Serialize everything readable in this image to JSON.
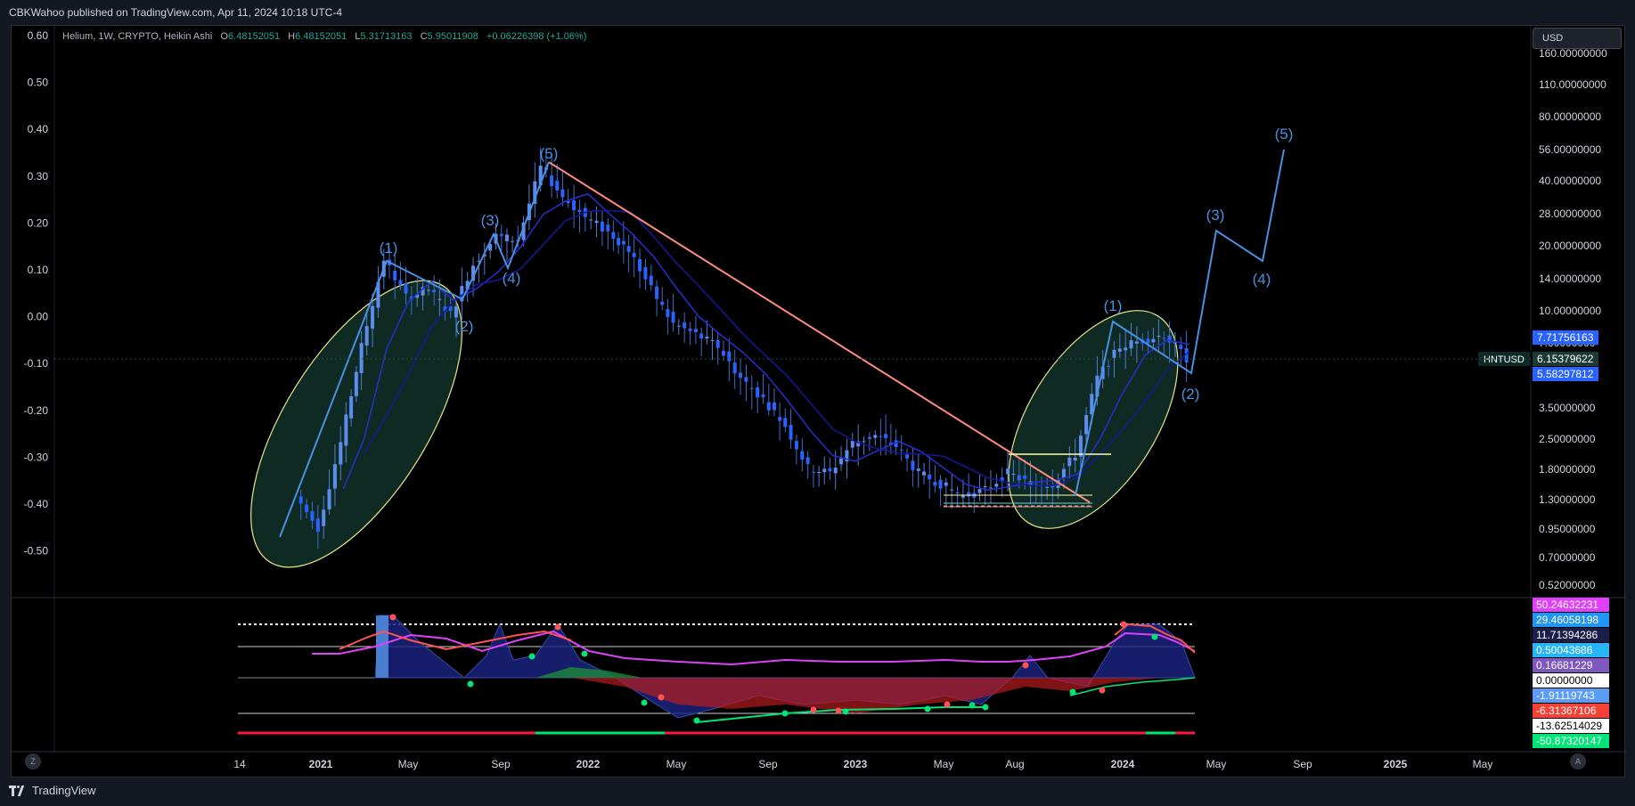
{
  "header": {
    "published_text": "CBKWahoo published on TradingView.com, Apr 11, 2024 10:18 UTC-4"
  },
  "legend": {
    "symbol_line": "Helium, 1W, CRYPTO, Heikin Ashi",
    "o_key": "O",
    "o_val": "6.48152051",
    "h_key": "H",
    "h_val": "6.48152051",
    "l_key": "L",
    "l_val": "5.31713163",
    "c_key": "C",
    "c_val": "5.95011908",
    "change": "+0.06226398 (+1.06%)"
  },
  "currency_button": "USD",
  "footer": {
    "brand": "TradingView",
    "z_button": "Z",
    "a_button": "A"
  },
  "colors": {
    "background": "#000000",
    "frame": "#131722",
    "candle": "#2962ff",
    "ma": "#1a1fbf",
    "wave": "#4a90e2",
    "trendline": "#ff8a80",
    "ellipse_stroke": "#e6e68a",
    "ellipse_fill": "#0f2a22",
    "range_line": "#ffffaa",
    "text": "#d1d4dc"
  },
  "chart_data": {
    "type": "candlestick",
    "title": "Helium, 1W, CRYPTO, Heikin Ashi",
    "symbol": "HNTUSD",
    "x_ticks": [
      "14",
      "2021",
      "May",
      "Sep",
      "2022",
      "May",
      "Sep",
      "2023",
      "May",
      "Aug",
      "2024",
      "May",
      "Sep",
      "2025",
      "May"
    ],
    "left_axis_ticks": [
      "0.60",
      "0.50",
      "0.40",
      "0.30",
      "0.20",
      "0.10",
      "0.00",
      "-0.10",
      "-0.20",
      "-0.30",
      "-0.40",
      "-0.50"
    ],
    "right_axis_ticks": [
      "160.00000000",
      "110.00000000",
      "80.00000000",
      "56.00000000",
      "40.00000000",
      "28.00000000",
      "20.00000000",
      "14.00000000",
      "10.00000000",
      "7.00000000",
      "3.50000000",
      "2.50000000",
      "1.80000000",
      "1.30000000",
      "0.95000000",
      "0.70000000",
      "0.52000000"
    ],
    "scale": "log",
    "price_labels": [
      {
        "text": "7.71756163",
        "color": "#2962ff"
      },
      {
        "text": "6.15379622",
        "color": "#1b3b36",
        "tag": "HNTUSD"
      },
      {
        "text": "5.58297812",
        "color": "#2962ff"
      }
    ],
    "series_close_approx": [
      {
        "t": "2020-12-01",
        "close": 1.4
      },
      {
        "t": "2021-01-01",
        "close": 1.0
      },
      {
        "t": "2021-02-01",
        "close": 2.5
      },
      {
        "t": "2021-03-01",
        "close": 7.0
      },
      {
        "t": "2021-04-01",
        "close": 18
      },
      {
        "t": "2021-05-01",
        "close": 12
      },
      {
        "t": "2021-06-01",
        "close": 13
      },
      {
        "t": "2021-07-01",
        "close": 10
      },
      {
        "t": "2021-08-01",
        "close": 17
      },
      {
        "t": "2021-09-01",
        "close": 23
      },
      {
        "t": "2021-10-01",
        "close": 22
      },
      {
        "t": "2021-11-01",
        "close": 48
      },
      {
        "t": "2021-12-01",
        "close": 35
      },
      {
        "t": "2022-01-01",
        "close": 28
      },
      {
        "t": "2022-02-01",
        "close": 24
      },
      {
        "t": "2022-03-01",
        "close": 20
      },
      {
        "t": "2022-04-01",
        "close": 13
      },
      {
        "t": "2022-05-01",
        "close": 9
      },
      {
        "t": "2022-06-01",
        "close": 8
      },
      {
        "t": "2022-07-01",
        "close": 7
      },
      {
        "t": "2022-08-01",
        "close": 5
      },
      {
        "t": "2022-09-01",
        "close": 4
      },
      {
        "t": "2022-10-01",
        "close": 3
      },
      {
        "t": "2022-11-01",
        "close": 1.9
      },
      {
        "t": "2022-12-01",
        "close": 1.8
      },
      {
        "t": "2023-01-01",
        "close": 2.5
      },
      {
        "t": "2023-02-01",
        "close": 2.7
      },
      {
        "t": "2023-03-01",
        "close": 2.4
      },
      {
        "t": "2023-04-01",
        "close": 1.8
      },
      {
        "t": "2023-05-01",
        "close": 1.6
      },
      {
        "t": "2023-06-01",
        "close": 1.4
      },
      {
        "t": "2023-07-01",
        "close": 1.5
      },
      {
        "t": "2023-08-01",
        "close": 1.8
      },
      {
        "t": "2023-09-01",
        "close": 1.6
      },
      {
        "t": "2023-10-01",
        "close": 1.6
      },
      {
        "t": "2023-11-01",
        "close": 2.2
      },
      {
        "t": "2023-12-01",
        "close": 5.0
      },
      {
        "t": "2024-01-01",
        "close": 7.0
      },
      {
        "t": "2024-02-01",
        "close": 7.5
      },
      {
        "t": "2024-03-01",
        "close": 8.0
      },
      {
        "t": "2024-04-01",
        "close": 6.15
      }
    ],
    "wave_labels": {
      "cycle1": [
        "(1)",
        "(2)",
        "(3)",
        "(4)",
        "(5)"
      ],
      "cycle2": [
        "(1)",
        "(2)",
        "(3)",
        "(4)",
        "(5)"
      ]
    },
    "oscillator_labels": [
      {
        "text": "50.24632231",
        "color": "#e040fb"
      },
      {
        "text": "29.46058198",
        "color": "#2196f3"
      },
      {
        "text": "11.71394286",
        "color": "#1a1f4a"
      },
      {
        "text": "0.50043686",
        "color": "#29b6f6"
      },
      {
        "text": "0.16681229",
        "color": "#7e57c2"
      },
      {
        "text": "0.00000000",
        "color": "#ffffff"
      },
      {
        "text": "-1.91119743",
        "color": "#5b9cf6"
      },
      {
        "text": "-6.31367106",
        "color": "#f44336"
      },
      {
        "text": "-13.62514029",
        "color": "#ffffff"
      },
      {
        "text": "-50.87320147",
        "color": "#00e676"
      }
    ]
  }
}
